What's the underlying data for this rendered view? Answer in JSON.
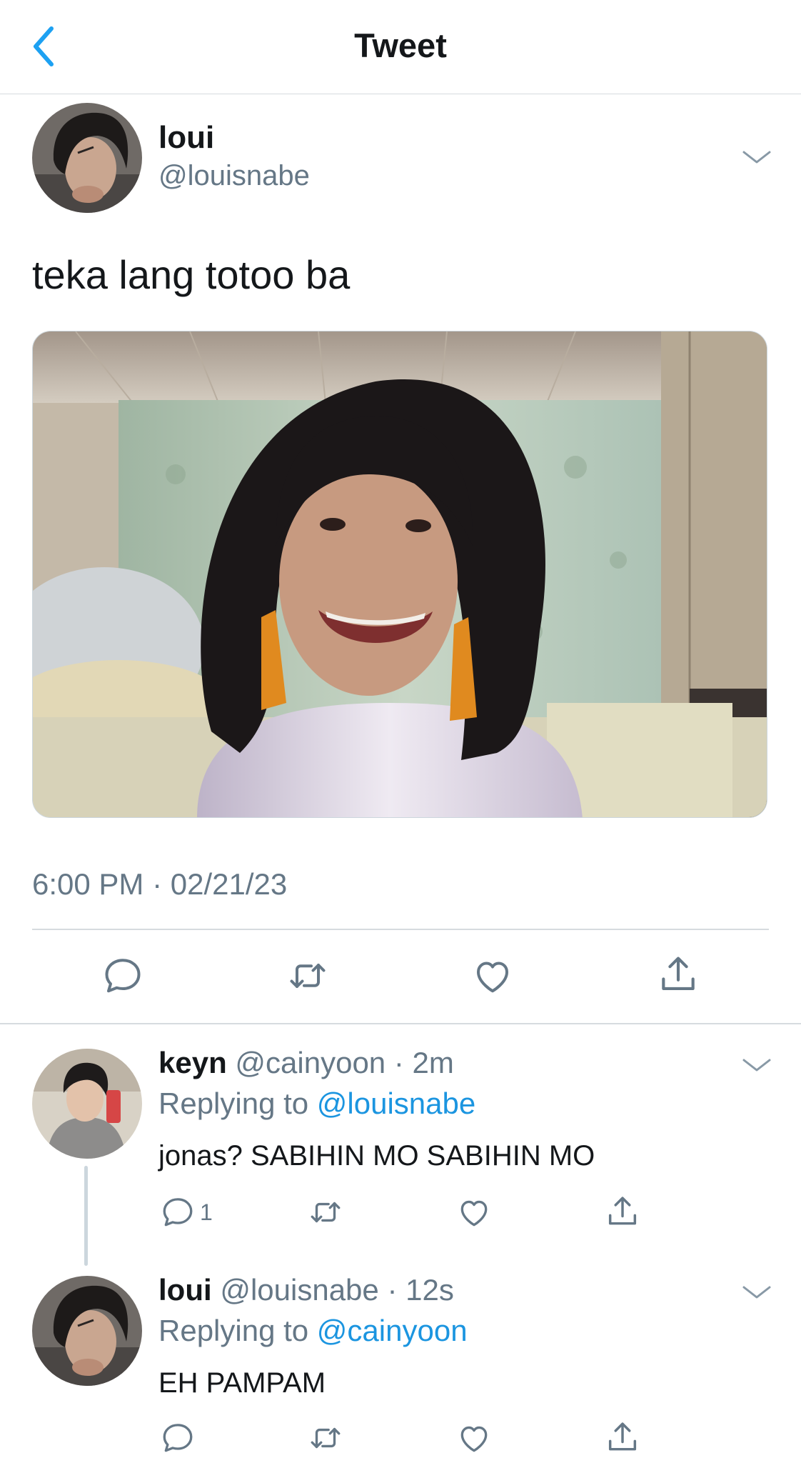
{
  "header": {
    "title": "Tweet",
    "back_icon": "chevron-left-icon",
    "accent_color": "#1da1f2"
  },
  "main_tweet": {
    "author_name": "loui",
    "author_handle": "@louisnabe",
    "text": "teka lang totoo ba",
    "timestamp": "6:00 PM · 02/21/23",
    "media": "photo"
  },
  "replies": [
    {
      "name": "keyn",
      "handle": "@cainyoon",
      "sep": "·",
      "time": "2m",
      "replying_prefix": "Replying to",
      "replying_to": "@louisnabe",
      "text": "jonas? SABIHIN MO SABIHIN MO",
      "reply_count": "1"
    },
    {
      "name": "loui",
      "handle": "@louisnabe",
      "sep": "·",
      "time": "12s",
      "replying_prefix": "Replying to",
      "replying_to": "@cainyoon",
      "text": "EH PAMPAM",
      "reply_count": ""
    }
  ],
  "icons": [
    "reply-icon",
    "retweet-icon",
    "like-icon",
    "share-icon",
    "chevron-down-icon"
  ],
  "colors": {
    "text_primary": "#14171a",
    "text_secondary": "#657786",
    "link": "#1b95e0",
    "divider": "#d6dbdf"
  }
}
